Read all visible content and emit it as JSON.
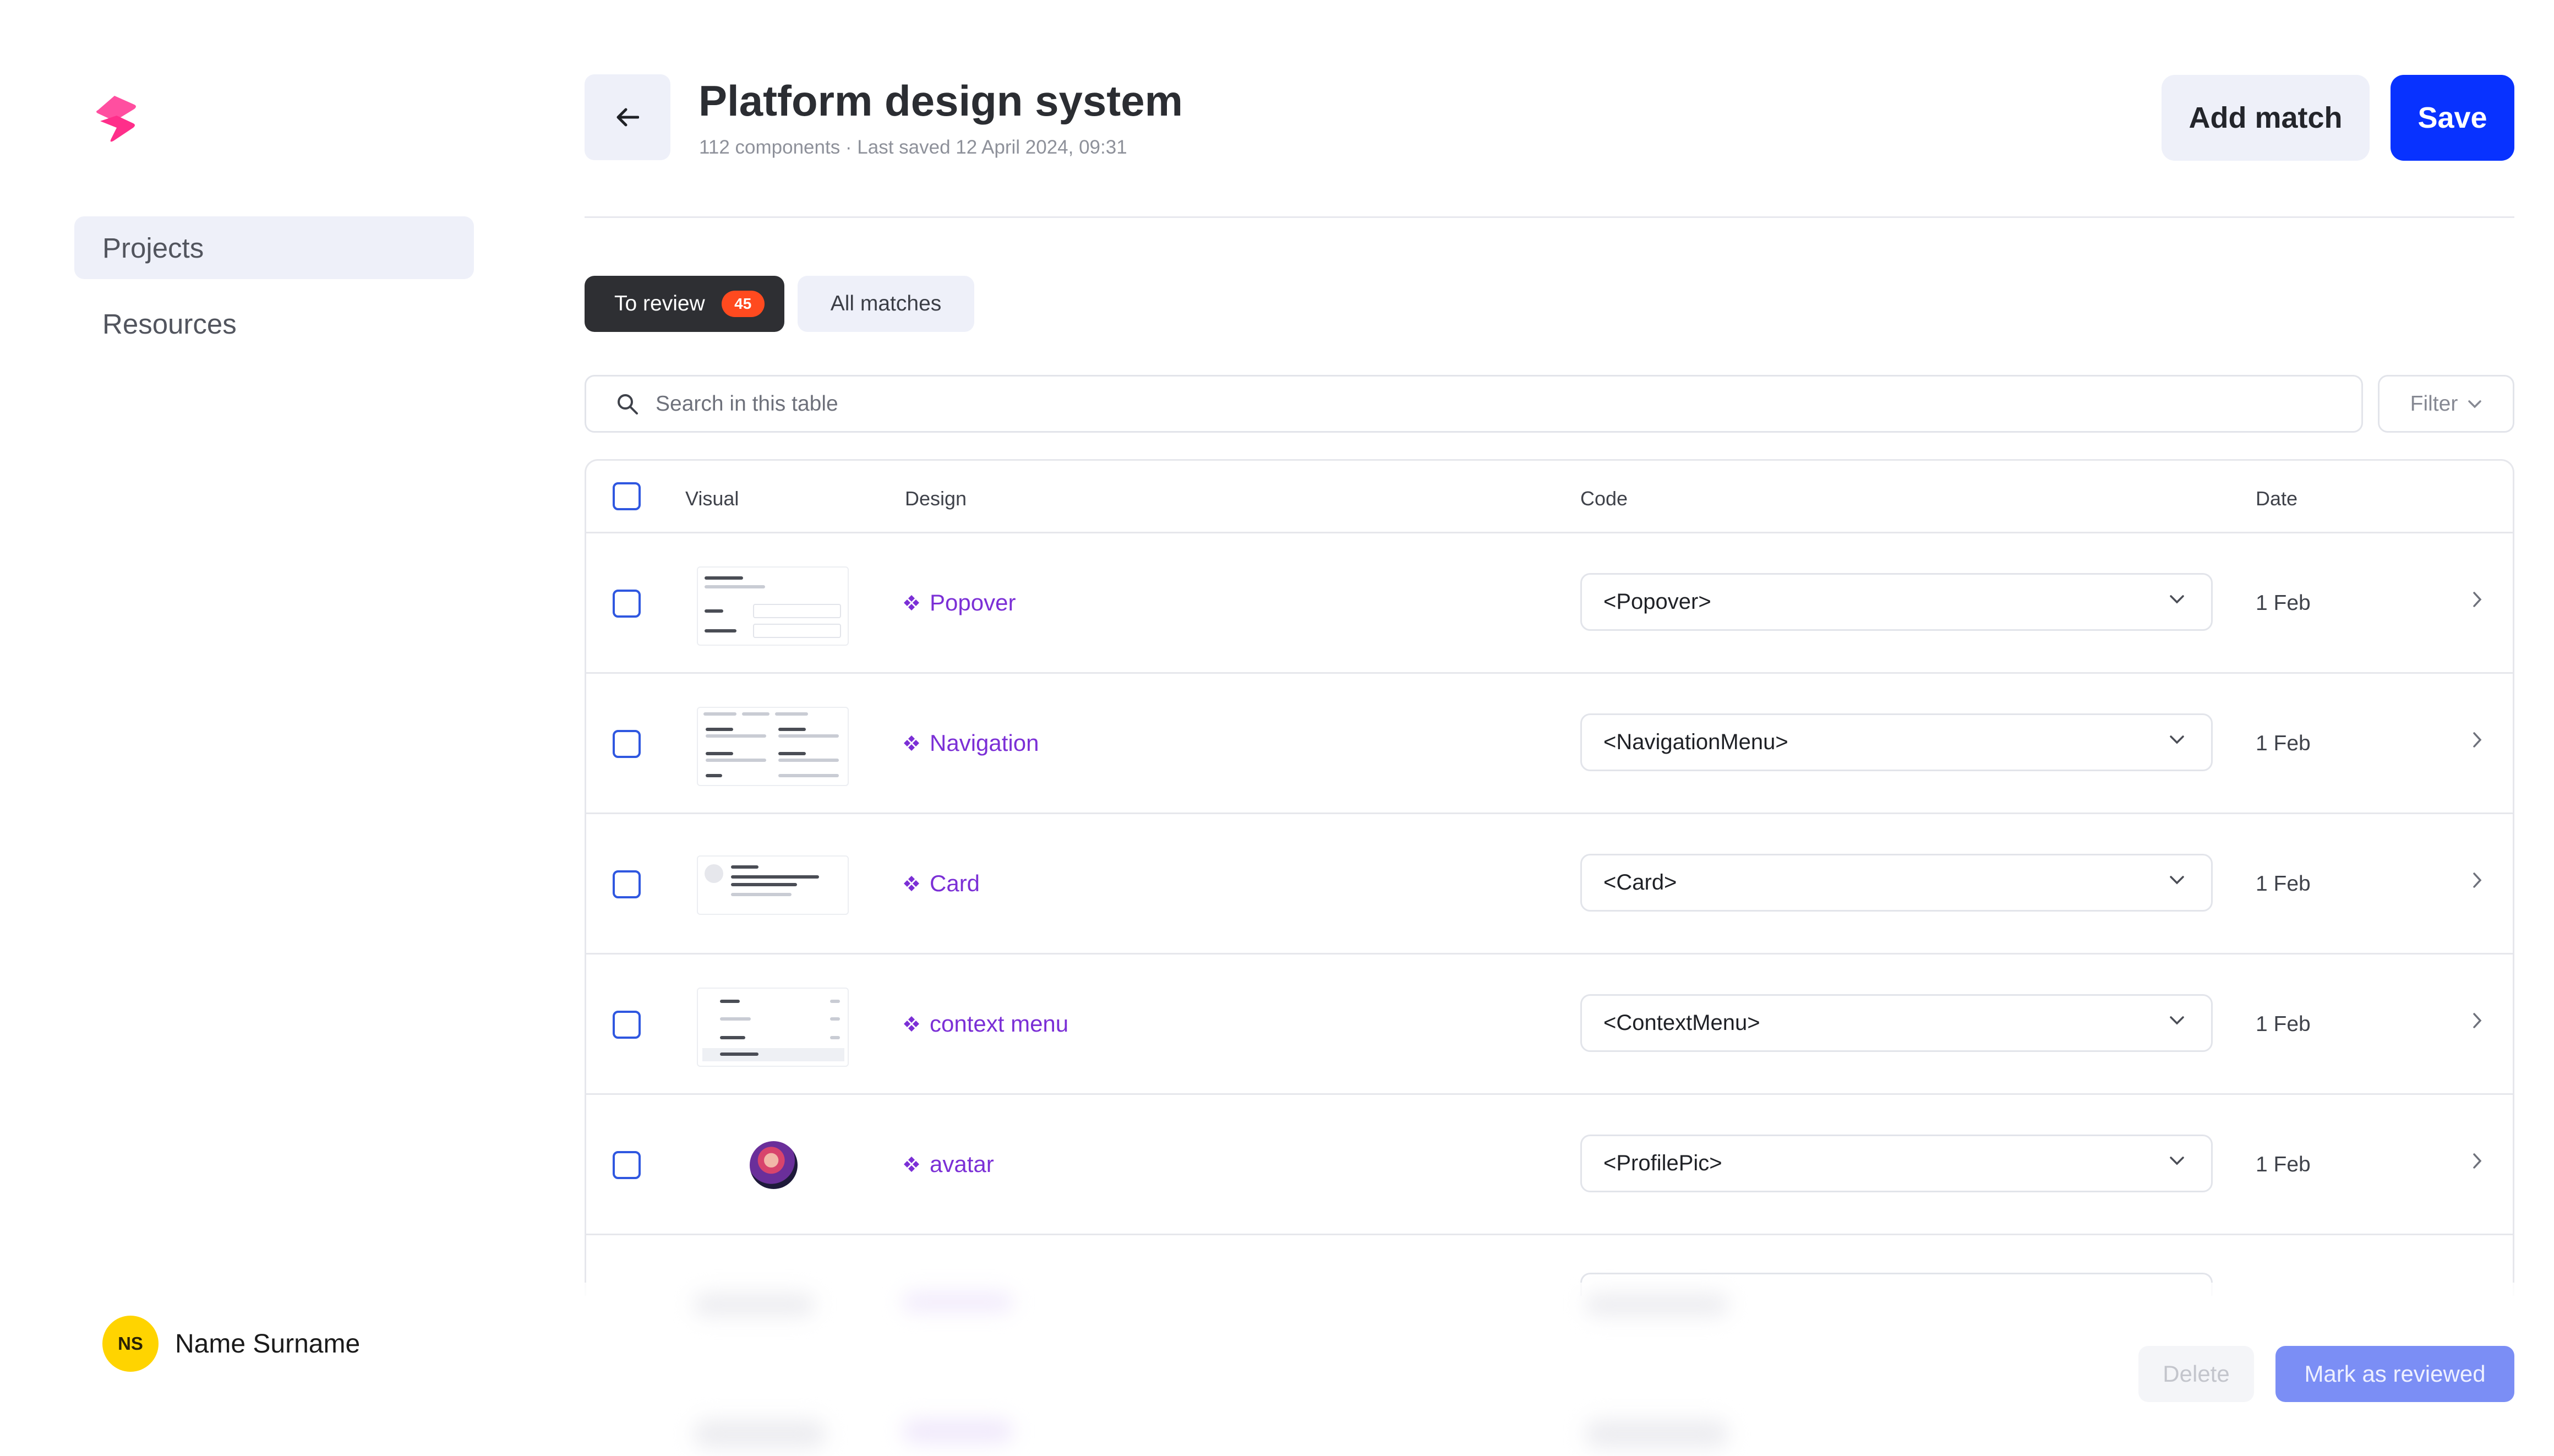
{
  "app": {
    "brand_color": "#ff2e8a",
    "accent": "#0832ff"
  },
  "sidebar": {
    "items": [
      {
        "label": "Projects",
        "active": true
      },
      {
        "label": "Resources",
        "active": false
      }
    ],
    "user": {
      "initials": "NS",
      "name": "Name Surname"
    }
  },
  "header": {
    "title": "Platform design system",
    "subtitle": "112 components · Last saved 12 April 2024, 09:31",
    "add_label": "Add match",
    "save_label": "Save"
  },
  "tabs": [
    {
      "label": "To review",
      "count": "45",
      "active": true
    },
    {
      "label": "All matches",
      "active": false
    }
  ],
  "search": {
    "placeholder": "Search in this table"
  },
  "filter": {
    "label": "Filter"
  },
  "table": {
    "columns": [
      "Visual",
      "Design",
      "Code",
      "Date"
    ],
    "rows": [
      {
        "design": "Popover",
        "code": "<Popover>",
        "date": "1 Feb",
        "visual": "popover-thumbnail"
      },
      {
        "design": "Navigation",
        "code": "<NavigationMenu>",
        "date": "1 Feb",
        "visual": "navigation-thumbnail"
      },
      {
        "design": "Card",
        "code": "<Card>",
        "date": "1 Feb",
        "visual": "card-thumbnail"
      },
      {
        "design": "context menu",
        "code": "<ContextMenu>",
        "date": "1 Feb",
        "visual": "context-menu-thumbnail"
      },
      {
        "design": "avatar",
        "code": "<ProfilePic>",
        "date": "1 Feb",
        "visual": "avatar-image"
      }
    ]
  },
  "footer": {
    "delete_label": "Delete",
    "mark_label": "Mark as reviewed"
  }
}
